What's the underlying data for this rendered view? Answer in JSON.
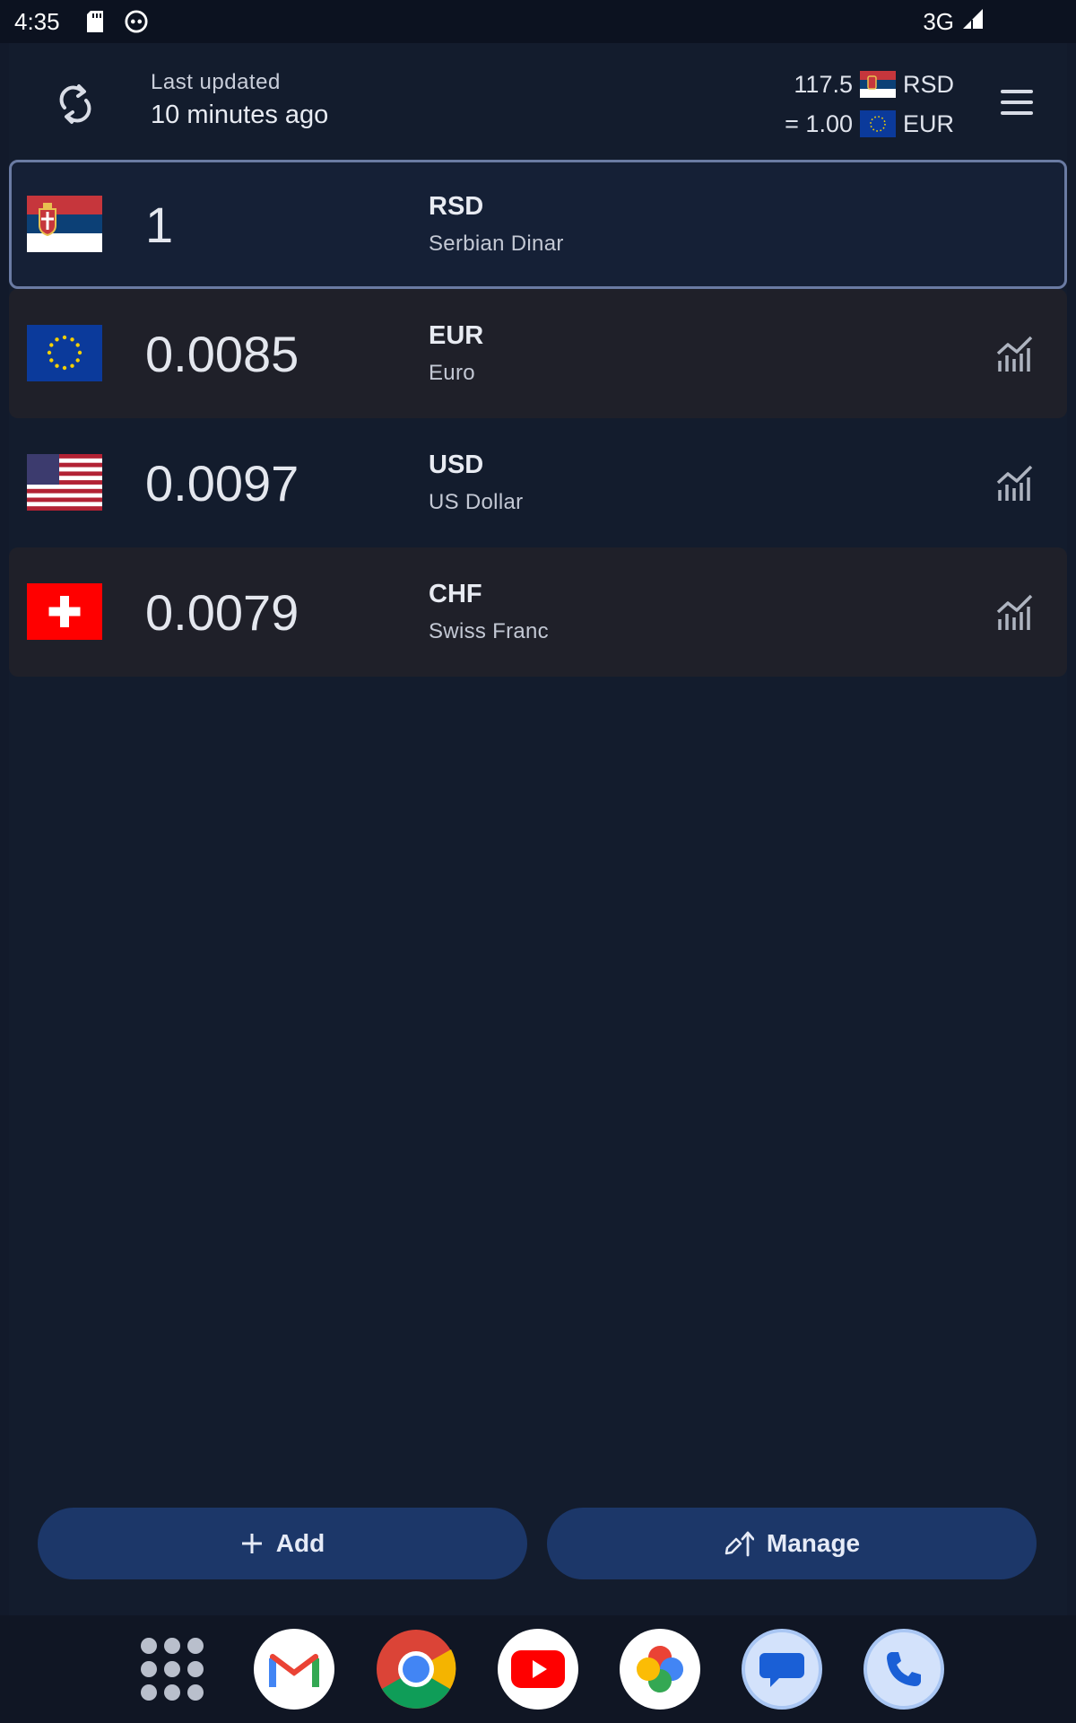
{
  "status_bar": {
    "time": "4:35",
    "network": "3G"
  },
  "header": {
    "updated_label": "Last updated",
    "updated_value": "10 minutes ago",
    "rate_top_value": "117.5",
    "rate_top_code": "RSD",
    "rate_bottom_value": "= 1.00",
    "rate_bottom_code": "EUR"
  },
  "currencies": [
    {
      "amount": "1",
      "code": "RSD",
      "name": "Serbian Dinar",
      "flag": "serbia-flag"
    },
    {
      "amount": "0.0085",
      "code": "EUR",
      "name": "Euro",
      "flag": "eu-flag"
    },
    {
      "amount": "0.0097",
      "code": "USD",
      "name": "US Dollar",
      "flag": "us-flag"
    },
    {
      "amount": "0.0079",
      "code": "CHF",
      "name": "Swiss Franc",
      "flag": "swiss-flag"
    }
  ],
  "actions": {
    "add_label": "Add",
    "manage_label": "Manage"
  },
  "dock": [
    "apps-grid-icon",
    "gmail-icon",
    "chrome-icon",
    "youtube-icon",
    "photos-icon",
    "messages-icon",
    "phone-icon"
  ],
  "colors": {
    "background": "#131c2d",
    "selected_border": "#6a7ba3",
    "button_fill": "#1c3769"
  }
}
